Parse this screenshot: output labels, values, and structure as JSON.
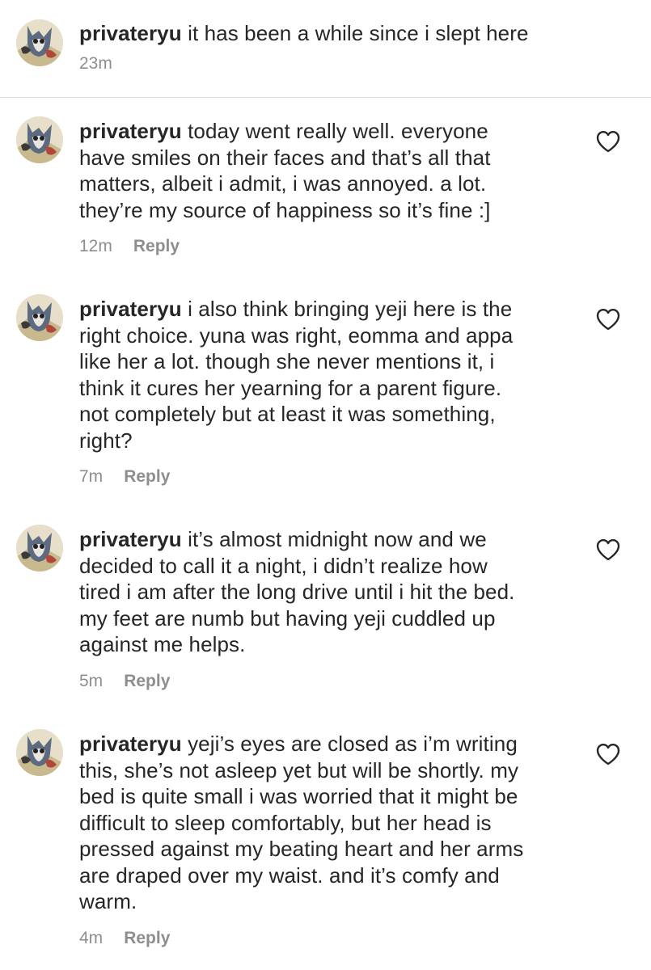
{
  "caption": {
    "username": "privateryu",
    "text": "it has been a while since i slept here",
    "time": "23m"
  },
  "comments": [
    {
      "username": "privateryu",
      "lines": [
        "today went really well. everyone",
        "have smiles on their faces and that’s all that",
        "matters, albeit i admit, i was annoyed. a lot.",
        "they’re my source of happiness so it’s fine :]"
      ],
      "time": "12m",
      "reply_label": "Reply"
    },
    {
      "username": "privateryu",
      "lines": [
        "i also think bringing yeji here is the",
        "right choice. yuna was right, eomma and appa",
        "like her a lot. though she never mentions it, i",
        "think it cures her yearning for a parent figure.",
        "not completely but at least it was something,",
        "right?"
      ],
      "time": "7m",
      "reply_label": "Reply"
    },
    {
      "username": "privateryu",
      "lines": [
        "it’s almost midnight now and we",
        "decided to call it a night, i didn’t realize how",
        "tired i am after the long drive until i hit the bed.",
        "my feet are numb but having yeji cuddled up",
        "against me helps."
      ],
      "time": "5m",
      "reply_label": "Reply"
    },
    {
      "username": "privateryu",
      "lines": [
        "yeji’s eyes are closed as i’m writing",
        "this, she’s not asleep yet but will be shortly. my",
        "bed is quite small i was worried that it might be",
        "difficult to sleep comfortably, but her head is",
        "pressed against my beating heart and her arms",
        "are draped over my waist. and it’s comfy and",
        "warm."
      ],
      "time": "4m",
      "reply_label": "Reply"
    }
  ],
  "icons": {
    "avatar": "cartoon-cat-avatar",
    "like": "heart-outline-icon"
  },
  "colors": {
    "text": "#262626",
    "muted": "#8e8e8e",
    "divider": "#dbdbdb"
  }
}
